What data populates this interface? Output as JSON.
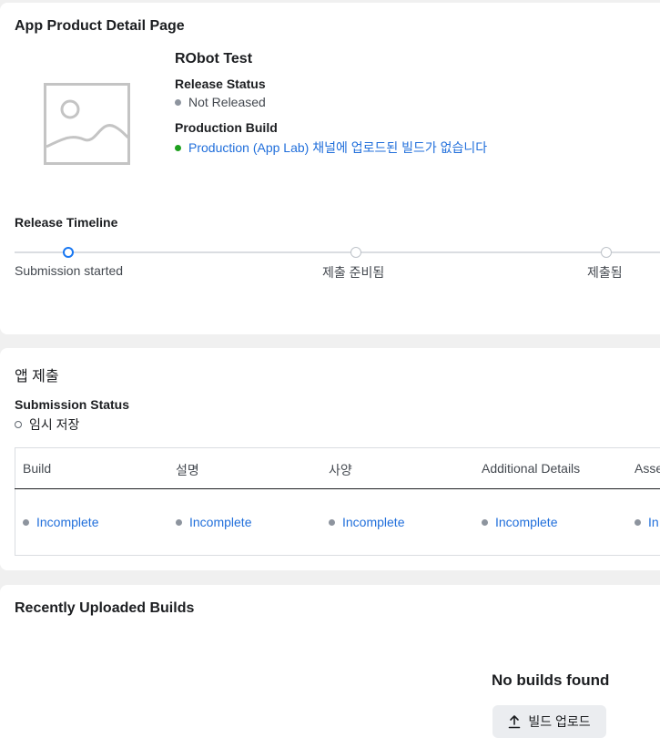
{
  "product_card": {
    "title": "App Product Detail Page",
    "app_name": "RObot Test",
    "release_status_label": "Release Status",
    "release_status_value": "Not Released",
    "production_build_label": "Production Build",
    "production_build_value": "Production (App Lab) 채널에 업로드된 빌드가 없습니다",
    "thumbnail_icon": "image-placeholder-icon",
    "timeline": {
      "label": "Release Timeline",
      "steps": [
        {
          "label": "Submission started",
          "active": true
        },
        {
          "label": "제출 준비됨",
          "active": false
        },
        {
          "label": "제출됨",
          "active": false
        }
      ]
    }
  },
  "submission_card": {
    "title": "앱 제출",
    "status_label": "Submission Status",
    "status_value": "임시 저장",
    "columns": [
      {
        "header": "Build",
        "status": "Incomplete"
      },
      {
        "header": "설명",
        "status": "Incomplete"
      },
      {
        "header": "사양",
        "status": "Incomplete"
      },
      {
        "header": "Additional Details",
        "status": "Incomplete"
      },
      {
        "header": "Asse",
        "status": "In"
      }
    ]
  },
  "builds_card": {
    "title": "Recently Uploaded Builds",
    "empty_title": "No builds found",
    "upload_button_label": "빌드 업로드",
    "upload_icon": "upload-icon"
  },
  "colors": {
    "link": "#216fdb",
    "accent": "#1877f2",
    "success": "#1ea01e",
    "muted_dot": "#8d949e"
  }
}
